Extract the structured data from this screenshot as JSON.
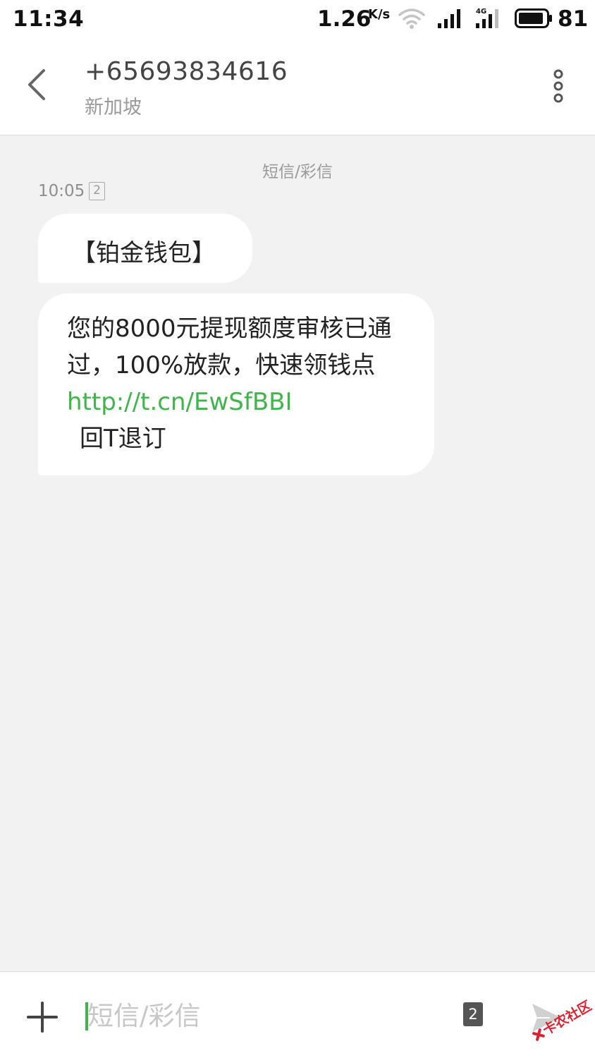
{
  "status_bar": {
    "time": "11:34",
    "net_speed": "1.26",
    "net_speed_unit": "K/s",
    "network_type": "4G",
    "battery": "81"
  },
  "header": {
    "contact_number": "+65693834616",
    "contact_location": "新加坡"
  },
  "conversation": {
    "message_type_label": "短信/彩信",
    "timestamp": "10:05",
    "sim_badge": "2",
    "messages": [
      {
        "text": "【铂金钱包】"
      },
      {
        "text_before_link": "您的8000元提现额度审核已通过，100%放款，快速领钱点 ",
        "link": "http://t.cn/EwSfBBI",
        "text_after_link": "回T退订"
      }
    ]
  },
  "input_bar": {
    "placeholder": "短信/彩信",
    "sim_select": "2"
  },
  "watermark": {
    "text": "卡农社区"
  },
  "colors": {
    "accent": "#3fb54a",
    "background": "#f2f2f2",
    "bubble": "#ffffff",
    "watermark": "#d9232e"
  }
}
